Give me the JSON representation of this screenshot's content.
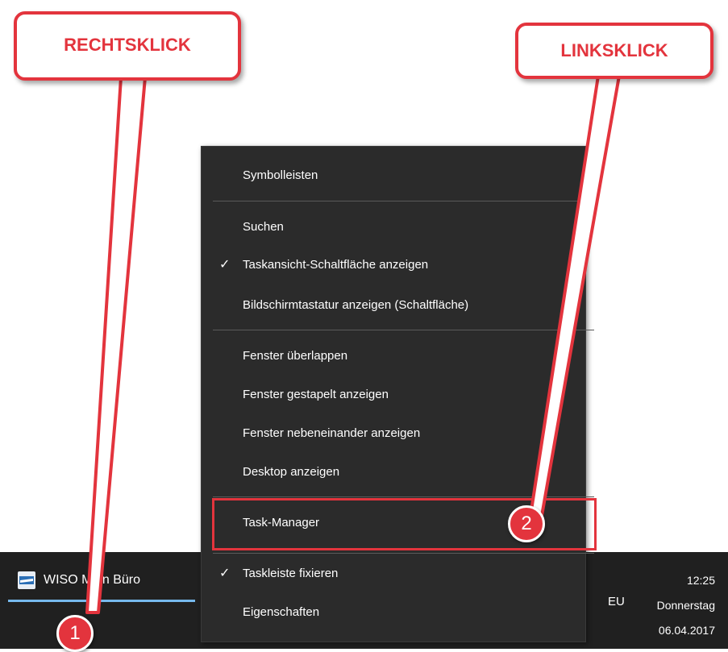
{
  "callouts": {
    "right_click": "RECHTSKLICK",
    "left_click": "LINKSKLICK"
  },
  "steps": {
    "step1": "1",
    "step2": "2"
  },
  "context_menu": {
    "items": [
      {
        "label": "Symbolleisten",
        "checked": false
      },
      {
        "label": "Suchen",
        "checked": false
      },
      {
        "label": "Taskansicht-Schaltfläche anzeigen",
        "checked": true
      },
      {
        "label": "Bildschirmtastatur anzeigen (Schaltfläche)",
        "checked": false
      },
      {
        "label": "Fenster überlappen",
        "checked": false
      },
      {
        "label": "Fenster gestapelt anzeigen",
        "checked": false
      },
      {
        "label": "Fenster nebeneinander anzeigen",
        "checked": false
      },
      {
        "label": "Desktop anzeigen",
        "checked": false
      },
      {
        "label": "Task-Manager",
        "checked": false,
        "highlighted": true
      },
      {
        "label": "Taskleiste fixieren",
        "checked": true
      },
      {
        "label": "Eigenschaften",
        "checked": false
      }
    ],
    "check_glyph": "✓"
  },
  "taskbar": {
    "app_label": "WISO Mein Büro",
    "app_icon": "wiso-app-icon",
    "language": "EU",
    "clock": {
      "time": "12:25",
      "weekday": "Donnerstag",
      "date": "06.04.2017"
    }
  },
  "colors": {
    "accent_red": "#e3343d",
    "menu_bg": "#2b2b2b",
    "taskbar_bg": "#202020",
    "active_task": "#76b9ed"
  }
}
